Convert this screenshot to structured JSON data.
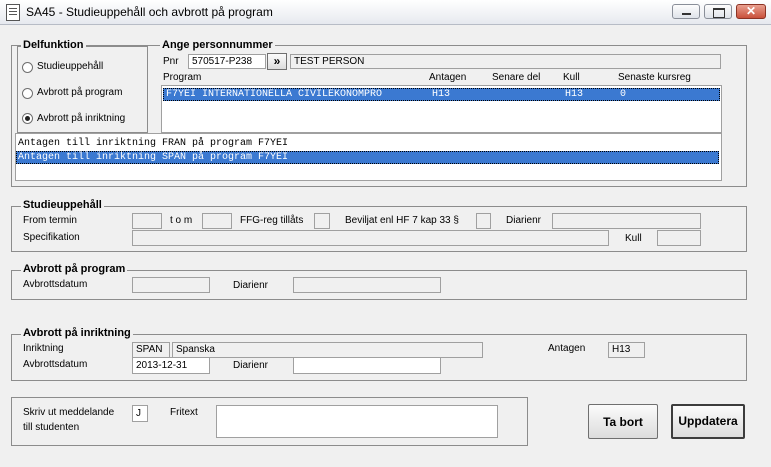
{
  "window": {
    "title": "SA45 - Studieuppehåll och avbrott på program"
  },
  "delfunktion": {
    "legend": "Delfunktion",
    "options": [
      {
        "label": "Studieuppehåll",
        "selected": false
      },
      {
        "label": "Avbrott på program",
        "selected": false
      },
      {
        "label": "Avbrott på inriktning",
        "selected": true
      }
    ]
  },
  "personnummer": {
    "legend": "Ange personnummer",
    "pnr_label": "Pnr",
    "pnr_value": "570517-P238",
    "go_button": "»",
    "name": "TEST PERSON"
  },
  "program_table": {
    "headers": [
      "Program",
      "Antagen",
      "Senare del",
      "Kull",
      "Senaste kursreg"
    ],
    "rows": [
      {
        "program": "F7YEI INTERNATIONELLA CIVILEKONOMPRO",
        "antagen": "H13",
        "senare_del": "",
        "kull": "H13",
        "senaste_kursreg": "0"
      }
    ]
  },
  "inriktning_list": [
    "Antagen till inriktning FRAN på program F7YEI",
    "Antagen till inriktning SPAN på program F7YEI"
  ],
  "studieuppehall": {
    "legend": "Studieuppehåll",
    "from_termin": "From termin",
    "tom": "t o m",
    "ffg_reg": "FFG-reg tillåts",
    "beviljat": "Beviljat enl HF 7 kap 33 §",
    "diarienr": "Diarienr",
    "specifikation": "Specifikation",
    "kull": "Kull"
  },
  "avbrott_program": {
    "legend": "Avbrott på program",
    "avbrottsdatum": "Avbrottsdatum",
    "diarienr": "Diarienr"
  },
  "avbrott_inriktning": {
    "legend": "Avbrott på inriktning",
    "inriktning_label": "Inriktning",
    "inriktning_code": "SPAN",
    "inriktning_name": "Spanska",
    "antagen_label": "Antagen",
    "antagen_value": "H13",
    "avbrottsdatum_label": "Avbrottsdatum",
    "avbrottsdatum_value": "2013-12-31",
    "diarienr_label": "Diarienr"
  },
  "meddelande": {
    "label_line1": "Skriv ut meddelande",
    "label_line2": "till studenten",
    "value": "J",
    "fritext_label": "Fritext"
  },
  "buttons": {
    "ta_bort": "Ta bort",
    "uppdatera": "Uppdatera"
  }
}
